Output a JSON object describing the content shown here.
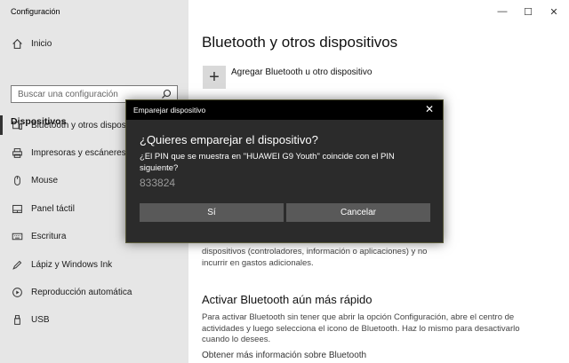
{
  "window": {
    "title": "Configuración",
    "minimize_glyph": "—",
    "maximize_glyph": "☐",
    "close_glyph": "✕"
  },
  "sidebar": {
    "home_label": "Inicio",
    "search_placeholder": "Buscar una configuración",
    "section_title": "Dispositivos",
    "items": [
      {
        "label": "Bluetooth y otros dispositivos",
        "icon": "bluetooth-devices-icon",
        "selected": true
      },
      {
        "label": "Impresoras y escáneres",
        "icon": "printer-icon"
      },
      {
        "label": "Mouse",
        "icon": "mouse-icon"
      },
      {
        "label": "Panel táctil",
        "icon": "touchpad-icon"
      },
      {
        "label": "Escritura",
        "icon": "keyboard-icon"
      },
      {
        "label": "Lápiz y Windows Ink",
        "icon": "pen-icon"
      },
      {
        "label": "Reproducción automática",
        "icon": "autoplay-icon"
      },
      {
        "label": "USB",
        "icon": "usb-icon"
      }
    ]
  },
  "main": {
    "title": "Bluetooth y otros dispositivos",
    "add_label": "Agregar Bluetooth u otro dispositivo",
    "partial_text": "dispositivos (controladores, información o aplicaciones) y no incurrir en gastos adicionales.",
    "fast_title": "Activar Bluetooth aún más rápido",
    "fast_text": "Para activar Bluetooth sin tener que abrir la opción Configuración, abre el centro de actividades y luego selecciona el icono de Bluetooth. Haz lo mismo para desactivarlo cuando lo desees.",
    "more_info_link": "Obtener más información sobre Bluetooth"
  },
  "dialog": {
    "title": "Emparejar dispositivo",
    "close_glyph": "✕",
    "heading": "¿Quieres emparejar el dispositivo?",
    "text": "¿El PIN que se muestra en \"HUAWEI G9 Youth\" coincide con el PIN siguiente?",
    "pin": "833824",
    "yes_label": "Sí",
    "cancel_label": "Cancelar"
  },
  "colors": {
    "sidebar_bg": "#e6e6e6",
    "dialog_bg": "#2b2b2b",
    "dialog_button": "#595959"
  }
}
